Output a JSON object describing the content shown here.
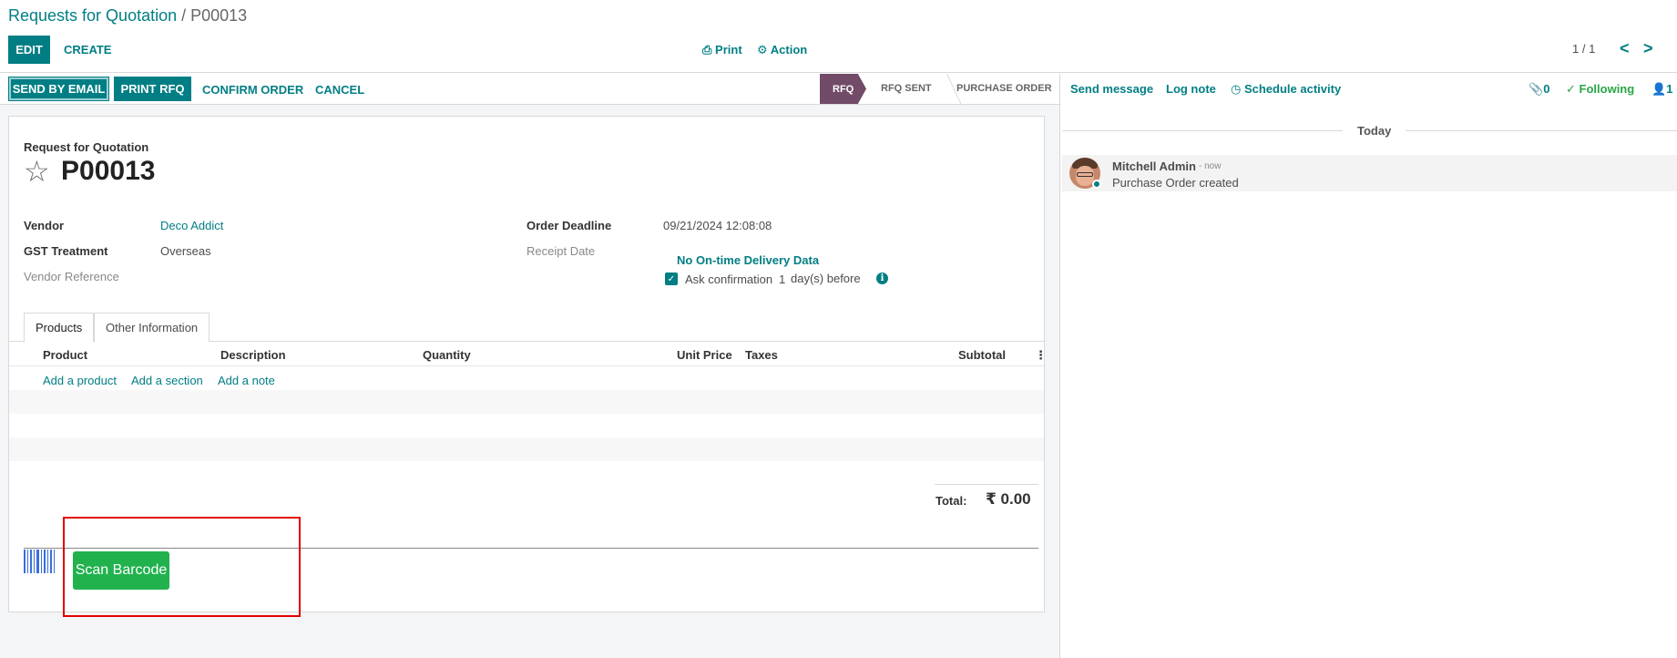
{
  "breadcrumb": {
    "parent": "Requests for Quotation",
    "separator": " / ",
    "current": "P00013"
  },
  "control_panel": {
    "edit_label": "EDIT",
    "create_label": "CREATE",
    "print_label": "Print",
    "action_label": "Action",
    "pager_value": "1 / 1",
    "prev_glyph": "<",
    "next_glyph": ">"
  },
  "statusbar": {
    "send_email_label": "SEND BY EMAIL",
    "print_rfq_label": "PRINT RFQ",
    "confirm_label": "CONFIRM ORDER",
    "cancel_label": "CANCEL",
    "stages": [
      "RFQ",
      "RFQ SENT",
      "PURCHASE ORDER"
    ],
    "active_stage": "RFQ"
  },
  "form": {
    "doc_label": "Request for Quotation",
    "doc_name": "P00013",
    "vendor_label": "Vendor",
    "vendor_value": "Deco Addict",
    "gst_label": "GST Treatment",
    "gst_value": "Overseas",
    "vendor_ref_label": "Vendor Reference",
    "order_deadline_label": "Order Deadline",
    "order_deadline_value": "09/21/2024 12:08:08",
    "receipt_date_label": "Receipt Date",
    "delivery_data_label": "No On-time Delivery Data",
    "ask_confirmation_label": "Ask confirmation",
    "ask_confirmation_days": "1",
    "ask_confirmation_suffix": "day(s) before",
    "ask_confirmation_checked": true
  },
  "tabs": [
    {
      "label": "Products",
      "active": true
    },
    {
      "label": "Other Information",
      "active": false
    }
  ],
  "table": {
    "columns": [
      "Product",
      "Description",
      "Quantity",
      "Unit Price",
      "Taxes",
      "Subtotal"
    ],
    "add_product": "Add a product",
    "add_section": "Add a section",
    "add_note": "Add a note"
  },
  "totals": {
    "label": "Total:",
    "value": "₹ 0.00"
  },
  "barcode": {
    "button_label": "Scan Barcode",
    "icon": "barcode-icon"
  },
  "chatter": {
    "send_message": "Send message",
    "log_note": "Log note",
    "schedule_activity": "Schedule activity",
    "attachments_count": "0",
    "following_label": "Following",
    "followers_count": "1",
    "today_label": "Today",
    "messages": [
      {
        "author": "Mitchell Admin",
        "time": "- now",
        "body": "Purchase Order created"
      }
    ]
  },
  "colors": {
    "primary": "#017e84",
    "stage_active": "#714b67",
    "scan_button": "#21b24e",
    "following": "#28a745",
    "highlight": "#e00000"
  }
}
